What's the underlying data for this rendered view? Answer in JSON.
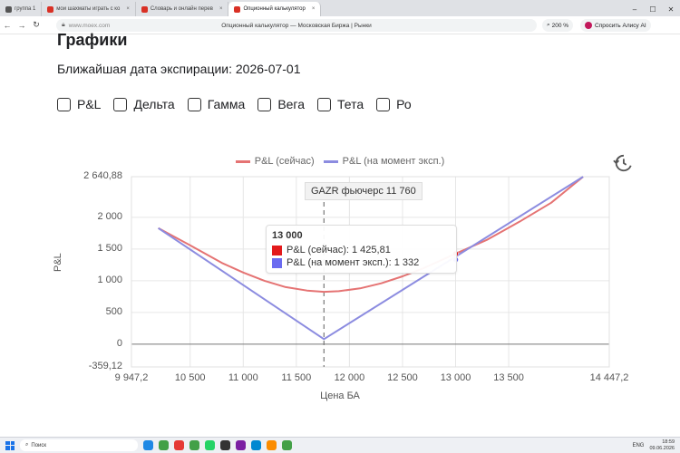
{
  "browser": {
    "tabs": [
      {
        "label": "группа 1",
        "color": "#555555",
        "active": false
      },
      {
        "label": "мои шахматы играть с ко",
        "color": "#d93025",
        "active": false
      },
      {
        "label": "Словарь и онлайн перев",
        "color": "#d93025",
        "active": false
      },
      {
        "label": "Опционный калькулятор",
        "color": "#d93025",
        "active": true
      }
    ],
    "url_host": "www.moex.com",
    "page_title": "Опционный калькулятор — Московская Биржа | Рынки",
    "zoom": "200 %",
    "alisa_label": "Спросить Алису AI"
  },
  "page": {
    "heading": "Графики",
    "expiry_text": "Ближайшая дата экспирации: 2026-07-01",
    "checkboxes": [
      {
        "label": "P&L",
        "checked": false
      },
      {
        "label": "Дельта",
        "checked": false
      },
      {
        "label": "Гамма",
        "checked": false
      },
      {
        "label": "Вега",
        "checked": false
      },
      {
        "label": "Тета",
        "checked": false
      },
      {
        "label": "Ро",
        "checked": false
      }
    ]
  },
  "chart_data": {
    "type": "line",
    "legend": [
      "P&L (сейчас)",
      "P&L (на момент эксп.)"
    ],
    "legend_position": "top",
    "xlabel": "Цена БА",
    "ylabel": "P&L",
    "xlim": [
      9947.2,
      14447.2
    ],
    "ylim": [
      -359.12,
      2640.88
    ],
    "x_ticks": [
      "9 947,2",
      "10 500",
      "11 000",
      "11 500",
      "12 000",
      "12 500",
      "13 000",
      "13 500",
      "14 447,2"
    ],
    "x_tick_values": [
      9947.2,
      10500,
      11000,
      11500,
      12000,
      12500,
      13000,
      13500,
      14447.2
    ],
    "y_ticks": [
      "2 640,88",
      "2 000",
      "1 500",
      "1 000",
      "500",
      "0",
      "-359,12"
    ],
    "y_tick_values": [
      2640.88,
      2000,
      1500,
      1000,
      500,
      0,
      -359.12
    ],
    "grid": true,
    "series": [
      {
        "name": "P&L (сейчас)",
        "color": "#e57373",
        "x": [
          10200,
          10500,
          10800,
          11000,
          11200,
          11400,
          11600,
          11760,
          11900,
          12100,
          12300,
          12500,
          12700,
          13000,
          13300,
          13600,
          13900,
          14200
        ],
        "y": [
          1830,
          1560,
          1280,
          1130,
          1000,
          900,
          845,
          825,
          835,
          880,
          960,
          1070,
          1200,
          1426,
          1650,
          1930,
          2230,
          2640
        ]
      },
      {
        "name": "P&L (на момент эксп.)",
        "color": "#8c8ce0",
        "x": [
          10200,
          11760,
          14200
        ],
        "y": [
          1830,
          80,
          2640
        ]
      }
    ],
    "vline": {
      "x": 11760,
      "label": "GAZR фьючерс 11 760"
    },
    "tooltip": {
      "x_label": "13 000",
      "x": 13000,
      "rows": [
        {
          "label": "P&L (сейчас): 1 425,81",
          "color": "#e31a1c",
          "value": 1425.81
        },
        {
          "label": "P&L (на момент эксп.): 1 332",
          "color": "#6b6bf0",
          "value": 1332
        }
      ]
    }
  },
  "taskbar": {
    "search_label": "Поиск",
    "lang": "ENG",
    "time": "18:59",
    "date": "09.06.2026"
  }
}
